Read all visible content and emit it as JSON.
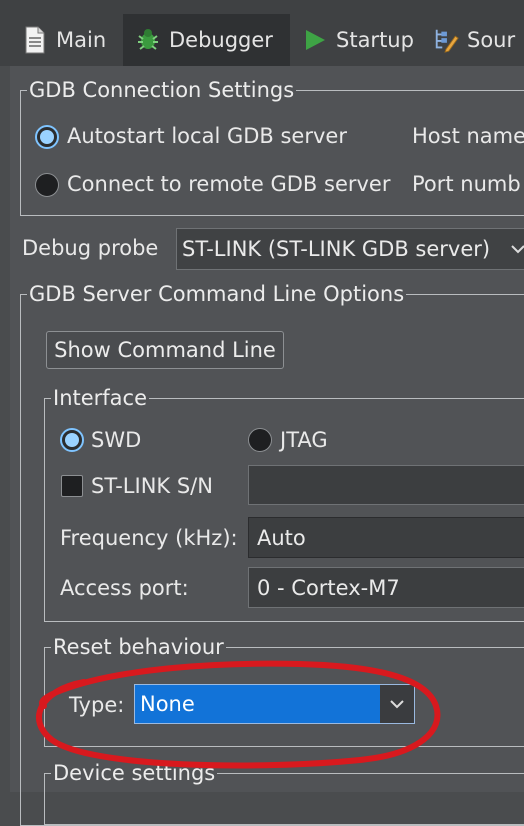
{
  "tabs": [
    {
      "label": "Main",
      "icon": "document-icon"
    },
    {
      "label": "Debugger",
      "icon": "bug-icon",
      "active": true
    },
    {
      "label": "Startup",
      "icon": "play-icon"
    },
    {
      "label": "Sour",
      "icon": "source-icon"
    }
  ],
  "gdb_connection": {
    "legend": "GDB Connection Settings",
    "autostart_label": "Autostart local GDB server",
    "remote_label": "Connect to remote GDB server",
    "host_label": "Host name",
    "port_label": "Port numb",
    "selected": "autostart"
  },
  "debug_probe": {
    "label": "Debug probe",
    "value": "ST-LINK (ST-LINK GDB server)"
  },
  "gdb_server": {
    "legend": "GDB Server Command Line Options",
    "show_button": "Show Command Line",
    "interface": {
      "legend": "Interface",
      "swd_label": "SWD",
      "jtag_label": "JTAG",
      "selected": "SWD",
      "stlink_sn_label": "ST-LINK S/N",
      "stlink_sn_value": "",
      "frequency_label": "Frequency (kHz):",
      "frequency_value": "Auto",
      "access_port_label": "Access port:",
      "access_port_value": "0 - Cortex-M7"
    },
    "reset": {
      "legend": "Reset behaviour",
      "type_label": "Type:",
      "type_value": "None"
    },
    "device_settings": {
      "legend": "Device settings"
    }
  },
  "colors": {
    "annotation": "#d8191e",
    "selection": "#1273d8",
    "radio_accent": "#9ad2ff"
  }
}
